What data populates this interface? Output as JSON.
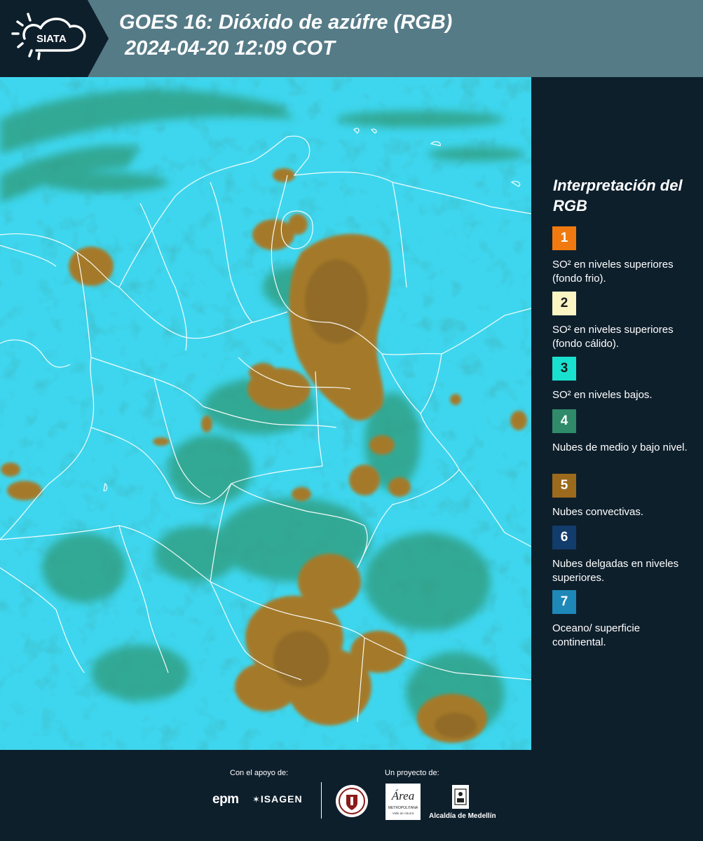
{
  "header": {
    "logo_text": "SIATA",
    "title": "GOES 16: Dióxido de azúfre (RGB)\n 2024-04-20 12:09 COT"
  },
  "map": {
    "image_alt": "Imagen satelital RGB de dióxido de azufre sobre Colombia y alrededores"
  },
  "legend": {
    "title": "Interpretación del RGB",
    "items": [
      {
        "number": "1",
        "color": "#f07a0f",
        "number_color": "#ffffff",
        "label": "SO² en niveles superiores (fondo frio)."
      },
      {
        "number": "2",
        "color": "#fbf4c3",
        "number_color": "#1a1a1a",
        "label": "SO² en niveles superiores (fondo cálido)."
      },
      {
        "number": "3",
        "color": "#19e1cf",
        "number_color": "#1a1a1a",
        "label": "SO² en niveles bajos."
      },
      {
        "number": "4",
        "color": "#2f8b6a",
        "number_color": "#ffffff",
        "label": "Nubes de medio y bajo nivel."
      },
      {
        "number": "5",
        "color": "#9c6a1c",
        "number_color": "#ffffff",
        "label": "Nubes convectivas."
      },
      {
        "number": "6",
        "color": "#113c6c",
        "number_color": "#ffffff",
        "label": "Nubes delgadas en niveles superiores."
      },
      {
        "number": "7",
        "color": "#1e88b8",
        "number_color": "#ffffff",
        "label": "Oceano/ superficie continental."
      }
    ]
  },
  "footer": {
    "support_label": "Con el apoyo de:",
    "project_label": "Un proyecto de:",
    "epm": "epm",
    "isagen": "ISAGEN",
    "area_main": "Área",
    "area_sub": "METROPOLITANA",
    "area_sub2": "Valle de Aburrá",
    "alcaldia": "Alcaldía de Medellín"
  }
}
